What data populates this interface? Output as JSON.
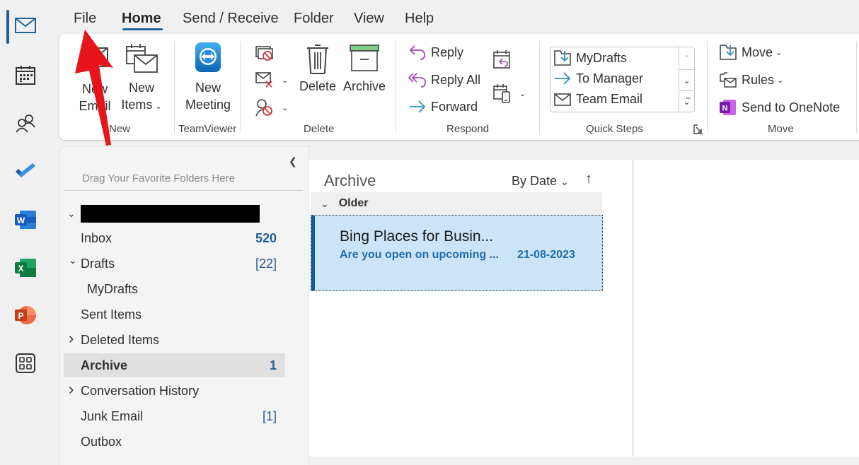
{
  "appbar": {
    "items": [
      {
        "name": "mail",
        "icon": "mail-icon",
        "active": true
      },
      {
        "name": "calendar",
        "icon": "calendar-icon"
      },
      {
        "name": "people",
        "icon": "people-icon"
      },
      {
        "name": "todo",
        "icon": "todo-icon"
      },
      {
        "name": "word",
        "icon": "word-icon",
        "letter": "W"
      },
      {
        "name": "excel",
        "icon": "excel-icon",
        "letter": "X"
      },
      {
        "name": "powerpoint",
        "icon": "powerpoint-icon",
        "letter": "P"
      },
      {
        "name": "more-apps",
        "icon": "apps-grid-icon"
      }
    ]
  },
  "tabs": {
    "file": "File",
    "home": "Home",
    "send_receive": "Send / Receive",
    "folder": "Folder",
    "view": "View",
    "help": "Help",
    "active": "Home"
  },
  "ribbon": {
    "new_group": {
      "label": "New",
      "new_email_line1": "New",
      "new_email_line2": "Email",
      "new_items_line1": "New",
      "new_items_line2": "Items"
    },
    "teamviewer_group": {
      "label": "TeamViewer",
      "new_meeting_line1": "New",
      "new_meeting_line2": "Meeting"
    },
    "delete_group": {
      "label": "Delete",
      "delete": "Delete",
      "archive": "Archive"
    },
    "respond_group": {
      "label": "Respond",
      "reply": "Reply",
      "reply_all": "Reply All",
      "forward": "Forward"
    },
    "quick_steps_group": {
      "label": "Quick Steps",
      "items": [
        "MyDrafts",
        "To Manager",
        "Team Email"
      ]
    },
    "move_group": {
      "label": "Move",
      "move": "Move",
      "rules": "Rules",
      "onenote": "Send to OneNote"
    }
  },
  "folder_pane": {
    "favorites_hint": "Drag Your Favorite Folders Here",
    "account_name": "",
    "folders": [
      {
        "name": "Inbox",
        "count": "520",
        "count_style": "bold"
      },
      {
        "name": "Drafts",
        "count": "[22]",
        "expander": "expanded"
      },
      {
        "name": "MyDrafts",
        "count": "",
        "indent": true
      },
      {
        "name": "Sent Items",
        "count": ""
      },
      {
        "name": "Deleted Items",
        "count": "",
        "expander": "collapsed"
      },
      {
        "name": "Archive",
        "count": "1",
        "count_style": "bold",
        "selected": true
      },
      {
        "name": "Conversation History",
        "count": "",
        "expander": "collapsed"
      },
      {
        "name": "Junk Email",
        "count": "[1]"
      },
      {
        "name": "Outbox",
        "count": ""
      }
    ]
  },
  "mail_list": {
    "title": "Archive",
    "sort_label": "By Date",
    "sort_direction_icon": "arrow-up-icon",
    "groups": [
      {
        "label": "Older",
        "items": [
          {
            "from": "Bing Places for Busin...",
            "subject": "Are you open on upcoming ...",
            "date": "21-08-2023",
            "selected": true,
            "unread": true
          }
        ]
      }
    ]
  },
  "colors": {
    "accent": "#1f5f9a",
    "selected_mail_bg": "#cce4f7",
    "unread_text": "#1f6fad",
    "annotation_arrow": "#e8141b"
  }
}
